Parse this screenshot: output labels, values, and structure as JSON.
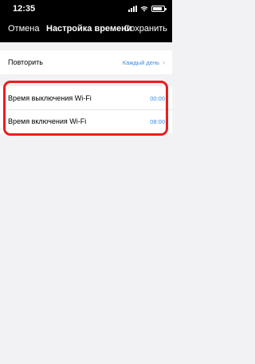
{
  "status": {
    "time": "12:35",
    "wifi_icon": "wifi-icon",
    "signal_icon": "signal-icon",
    "battery_icon": "battery-icon"
  },
  "nav": {
    "cancel": "Отмена",
    "title": "Настройка времени",
    "save": "Сохранить"
  },
  "repeat": {
    "label": "Повторить",
    "value": "Каждый день",
    "icon": "chevron-right-icon"
  },
  "schedule": {
    "off": {
      "label": "Время выключения Wi-Fi",
      "value": "00:00"
    },
    "on": {
      "label": "Время включения Wi-Fi",
      "value": "08:00"
    }
  },
  "colors": {
    "accent": "#3b8ce3",
    "highlight": "#ee1c1c",
    "background": "#f2f2f4",
    "header": "#000000"
  }
}
